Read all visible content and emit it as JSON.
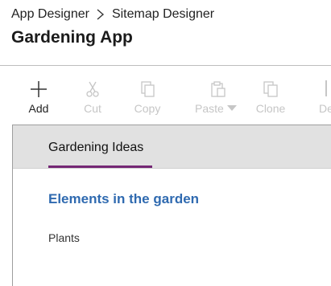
{
  "breadcrumb": {
    "parent": "App Designer",
    "current": "Sitemap Designer"
  },
  "page": {
    "title": "Gardening App"
  },
  "toolbar": {
    "add": "Add",
    "cut": "Cut",
    "copy": "Copy",
    "paste": "Paste",
    "clone": "Clone",
    "delete_partial": "De"
  },
  "sitemap": {
    "area": "Gardening Ideas",
    "group": "Elements in the garden",
    "subarea": "Plants"
  },
  "colors": {
    "accent_underline": "#742774",
    "group_title": "#2f6ab0",
    "disabled_text": "#c6c6c6"
  },
  "icons": [
    "plus-icon",
    "scissors-icon",
    "copy-icon",
    "paste-icon",
    "clone-icon",
    "chevron-right-icon",
    "caret-down-icon"
  ]
}
